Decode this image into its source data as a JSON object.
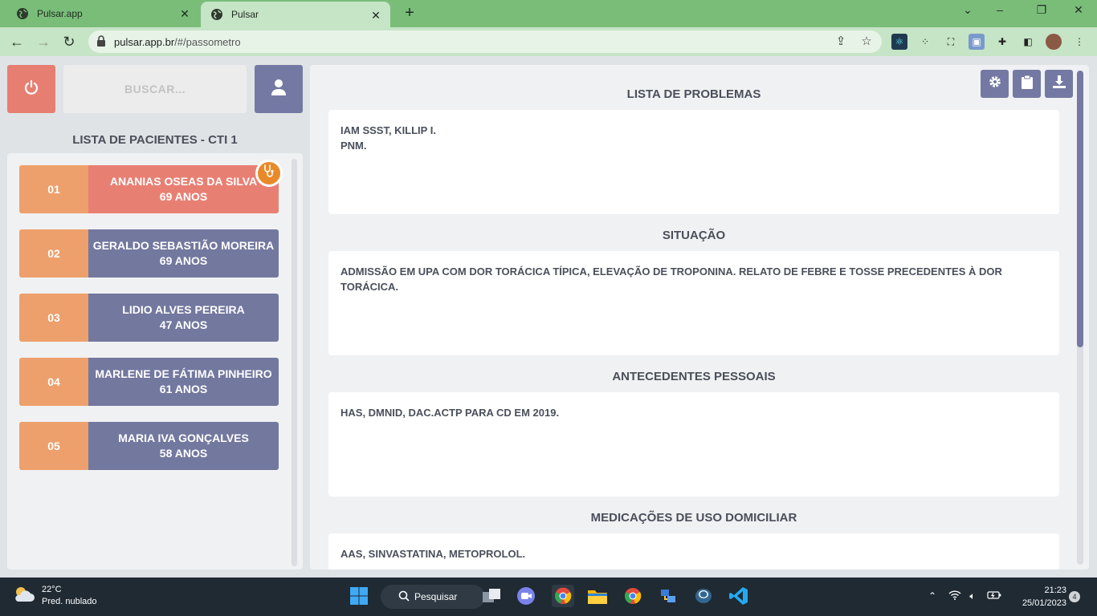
{
  "browser": {
    "tabs": [
      {
        "title": "Pulsar.app",
        "active": false
      },
      {
        "title": "Pulsar",
        "active": true
      }
    ],
    "url_host": "pulsar.app.br",
    "url_path": "/#/passometro",
    "colors": {
      "tabbar": "#79bd79",
      "toolbar": "#c6e4c6"
    }
  },
  "sidebar": {
    "search_placeholder": "BUSCAR...",
    "list_title": "LISTA DE PACIENTES - CTI 1",
    "patients": [
      {
        "number": "01",
        "name": "ANANIAS OSEAS DA SILVA",
        "age": "69 ANOS",
        "selected": true
      },
      {
        "number": "02",
        "name": "GERALDO SEBASTIÃO MOREIRA",
        "age": "69 ANOS",
        "selected": false
      },
      {
        "number": "03",
        "name": "LIDIO ALVES PEREIRA",
        "age": "47 ANOS",
        "selected": false
      },
      {
        "number": "04",
        "name": "MARLENE DE FÁTIMA PINHEIRO",
        "age": "61 ANOS",
        "selected": false
      },
      {
        "number": "05",
        "name": "MARIA IVA GONÇALVES",
        "age": "58 ANOS",
        "selected": false
      }
    ]
  },
  "main": {
    "sections": [
      {
        "title": "LISTA DE PROBLEMAS",
        "content": "IAM SSST, KILLIP I.\nPNM."
      },
      {
        "title": "SITUAÇÃO",
        "content": "ADMISSÃO EM UPA COM DOR TORÁCICA TÍPICA, ELEVAÇÃO DE TROPONINA. RELATO DE FEBRE E TOSSE PRECEDENTES À DOR TORÁCICA."
      },
      {
        "title": "ANTECEDENTES PESSOAIS",
        "content": "HAS, DMNID, DAC.ACTP PARA CD EM 2019."
      },
      {
        "title": "MEDICAÇÕES DE USO DOMICILIAR",
        "content": "AAS, SINVASTATINA, METOPROLOL."
      }
    ]
  },
  "colors": {
    "accent_purple": "#7479a3",
    "accent_red": "#e67f72",
    "accent_orange": "#eda06c",
    "badge_orange": "#e98a2a",
    "page_bg": "#dfe3e6"
  },
  "taskbar": {
    "temperature": "22°C",
    "weather": "Pred. nublado",
    "search_label": "Pesquisar",
    "time": "21:23",
    "date": "25/01/2023",
    "notifications": "4"
  }
}
